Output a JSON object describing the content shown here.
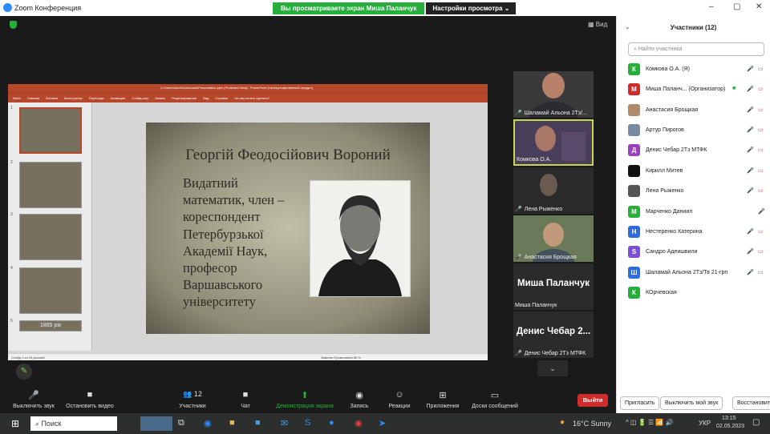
{
  "window": {
    "title": "Zoom Конференция",
    "minimize": "–",
    "maximize": "▢",
    "close": "✕"
  },
  "share_bar": {
    "message": "Вы просматриваете экран Миша Паланчук",
    "view_options": "Настройки просмотра  ⌄"
  },
  "meeting": {
    "view_label": "Вид"
  },
  "ppt": {
    "window_title": "C:\\Users\\User\\Downloads\\Presentation.pptx [Protected View] - PowerPoint (Нелицензированный продукт)",
    "tabs": [
      "Файл",
      "Главная",
      "Вставка",
      "Конструктор",
      "Переходы",
      "Анимация",
      "Слайд-шоу",
      "Запись",
      "Рецензирование",
      "Вид",
      "Справка",
      "Что вы хотите сделать?"
    ],
    "status_left": "Слайд 1 из 15   русский",
    "status_right": "Заметки   Примечания        85 %"
  },
  "slide": {
    "title": "Георгій Феодосійович Вороний",
    "body": [
      "Видатний",
      "математик, член –",
      "кореспондент",
      "Петербурзької",
      "Академії Наук,",
      "професор",
      "Варшавського",
      "університету"
    ]
  },
  "thumbs": [
    {
      "n": "1"
    },
    {
      "n": "2"
    },
    {
      "n": "3"
    },
    {
      "n": "4"
    },
    {
      "n": "5",
      "text": "1885 рік"
    }
  ],
  "video_tiles": [
    {
      "name": "Шаламай Альона 2Тз/..."
    },
    {
      "name": "Комкова О.А."
    },
    {
      "name": "Лена Рыженко"
    },
    {
      "name": "Анастасия Брощкая"
    },
    {
      "big": "Миша Паланчук",
      "name": "Миша Паланчук"
    },
    {
      "big": "Денис Чебар 2...",
      "name": "Денис Чебар 2Тз МТФК"
    }
  ],
  "toolbar": {
    "mute": "Выключить звук",
    "stop_video": "Остановить видео",
    "participants": "Участники",
    "participants_count": "12",
    "chat": "Чат",
    "share": "Демонстрация экрана",
    "record": "Запись",
    "reactions": "Реакции",
    "apps": "Приложения",
    "whiteboard": "Доски сообщений",
    "leave": "Выйти"
  },
  "participants": {
    "title": "Участники (12)",
    "search_placeholder": "Найти участника",
    "list": [
      {
        "initial": "К",
        "color": "#27ae3b",
        "name": "Комкова О.А. (Я)"
      },
      {
        "initial": "М",
        "color": "#d12c2c",
        "name": "Миша Паланч... (Организатор)"
      },
      {
        "initial": "",
        "color": "#b08a6a",
        "name": "Анастасия Брощкая"
      },
      {
        "initial": "",
        "color": "#7a8aa0",
        "name": "Артур Пирогов"
      },
      {
        "initial": "Д",
        "color": "#9b3fc0",
        "name": "Денис Чебар 2Тз МТФК"
      },
      {
        "initial": "",
        "color": "#111111",
        "name": "Кирилл Митев"
      },
      {
        "initial": "",
        "color": "#555555",
        "name": "Лена Рыженко"
      },
      {
        "initial": "М",
        "color": "#27ae3b",
        "name": "Марченко Даниил"
      },
      {
        "initial": "Н",
        "color": "#2d6cdf",
        "name": "Нестеренко Катерина"
      },
      {
        "initial": "S",
        "color": "#7b4fd6",
        "name": "Сандро Адеишвили"
      },
      {
        "initial": "Ш",
        "color": "#2d6cdf",
        "name": "Шаламай Альона 2Тз/Тв 21-грп"
      },
      {
        "initial": "К",
        "color": "#27ae3b",
        "name": "КОрчевская"
      }
    ],
    "invite": "Пригласить",
    "mute_me": "Выключить мой звук",
    "restore": "Восстановить"
  },
  "taskbar": {
    "search": "Поиск",
    "weather": "16°C  Sunny",
    "lang": "УКР",
    "time": "13:15",
    "date": "02.05.2023"
  }
}
